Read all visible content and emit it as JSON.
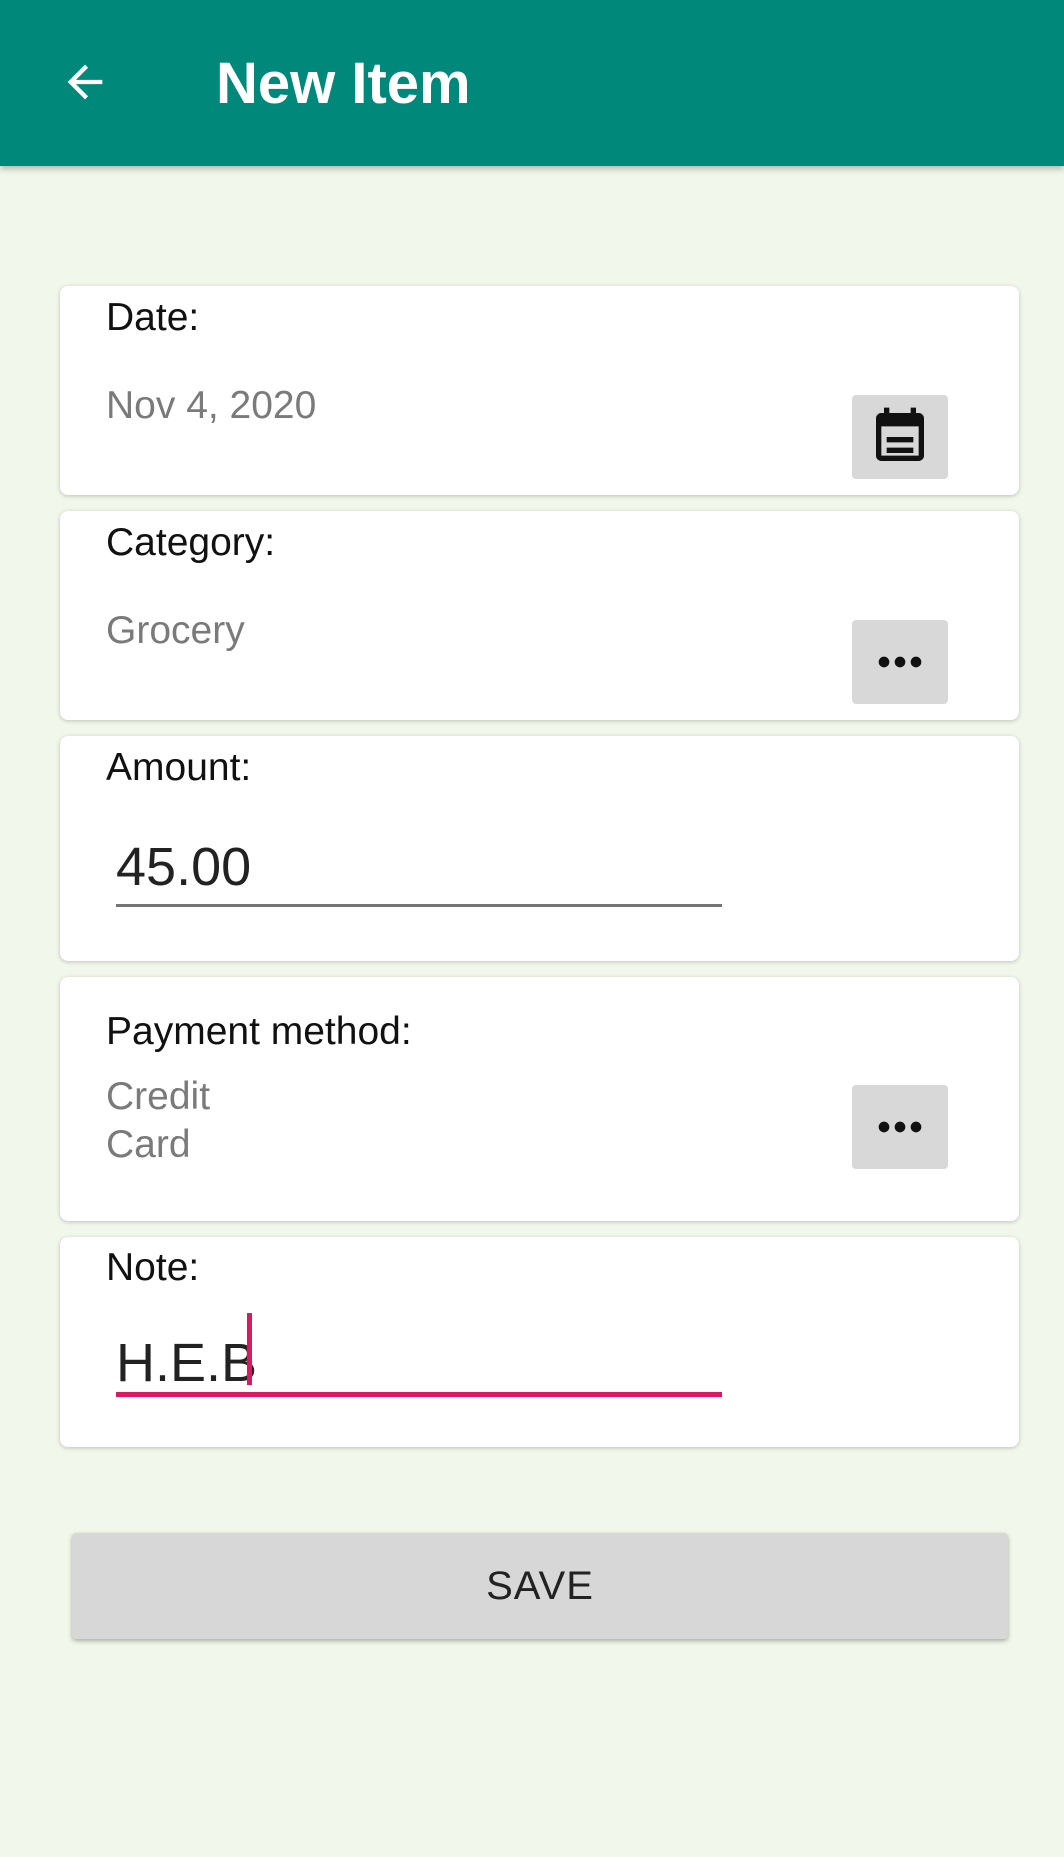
{
  "appbar": {
    "title": "New Item",
    "back_icon": "arrow-left-icon",
    "background_color": "#00887a"
  },
  "date_card": {
    "label": "Date:",
    "value": "Nov 4, 2020",
    "button_icon": "calendar-icon"
  },
  "category_card": {
    "label": "Category:",
    "value": "Grocery",
    "button_icon": "more-horiz-icon"
  },
  "amount_card": {
    "label": "Amount:",
    "value": "45.00"
  },
  "payment_card": {
    "label": "Payment method:",
    "value_line1": "Credit",
    "value_line2": "Card",
    "button_icon": "more-horiz-icon"
  },
  "note_card": {
    "label": "Note:",
    "value": "H.E.B",
    "focus_color": "#d81b60"
  },
  "save_button": {
    "label": "SAVE"
  }
}
